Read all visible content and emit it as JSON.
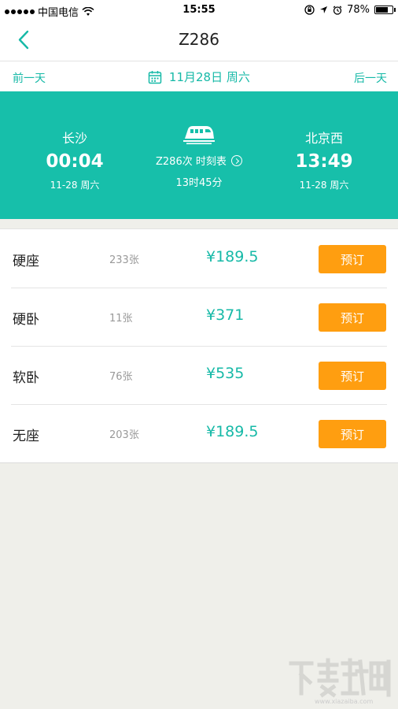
{
  "status_bar": {
    "carrier": "中国电信",
    "time": "15:55",
    "battery_text": "78%",
    "battery_level": 0.78
  },
  "nav": {
    "title": "Z286"
  },
  "date_bar": {
    "prev_label": "前一天",
    "date_label": "11月28日 周六",
    "next_label": "后一天"
  },
  "journey": {
    "from": {
      "station": "长沙",
      "time": "00:04",
      "date": "11-28 周六"
    },
    "to": {
      "station": "北京西",
      "time": "13:49",
      "date": "11-28 周六"
    },
    "train_code": "Z286次 时刻表",
    "duration": "13时45分"
  },
  "seats": [
    {
      "type": "硬座",
      "count": "233张",
      "price": "¥189.5",
      "action": "预订"
    },
    {
      "type": "硬卧",
      "count": "11张",
      "price": "¥371",
      "action": "预订"
    },
    {
      "type": "软卧",
      "count": "76张",
      "price": "¥535",
      "action": "预订"
    },
    {
      "type": "无座",
      "count": "203张",
      "price": "¥189.5",
      "action": "预订"
    }
  ],
  "watermark": {
    "url": "www.xiazaiba.com"
  },
  "colors": {
    "accent": "#17bfaa",
    "button": "#ff9e10",
    "background": "#efefea"
  }
}
